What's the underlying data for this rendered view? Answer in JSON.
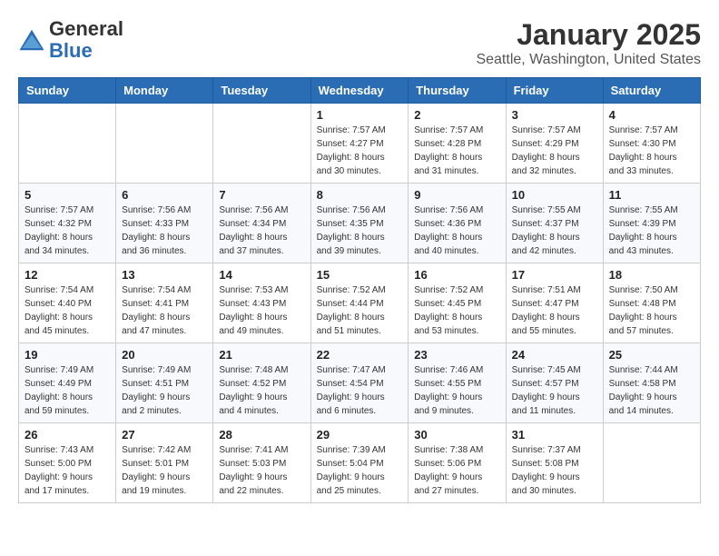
{
  "header": {
    "logo_line1": "General",
    "logo_line2": "Blue",
    "month": "January 2025",
    "location": "Seattle, Washington, United States"
  },
  "weekdays": [
    "Sunday",
    "Monday",
    "Tuesday",
    "Wednesday",
    "Thursday",
    "Friday",
    "Saturday"
  ],
  "weeks": [
    [
      {
        "day": "",
        "info": ""
      },
      {
        "day": "",
        "info": ""
      },
      {
        "day": "",
        "info": ""
      },
      {
        "day": "1",
        "info": "Sunrise: 7:57 AM\nSunset: 4:27 PM\nDaylight: 8 hours\nand 30 minutes."
      },
      {
        "day": "2",
        "info": "Sunrise: 7:57 AM\nSunset: 4:28 PM\nDaylight: 8 hours\nand 31 minutes."
      },
      {
        "day": "3",
        "info": "Sunrise: 7:57 AM\nSunset: 4:29 PM\nDaylight: 8 hours\nand 32 minutes."
      },
      {
        "day": "4",
        "info": "Sunrise: 7:57 AM\nSunset: 4:30 PM\nDaylight: 8 hours\nand 33 minutes."
      }
    ],
    [
      {
        "day": "5",
        "info": "Sunrise: 7:57 AM\nSunset: 4:32 PM\nDaylight: 8 hours\nand 34 minutes."
      },
      {
        "day": "6",
        "info": "Sunrise: 7:56 AM\nSunset: 4:33 PM\nDaylight: 8 hours\nand 36 minutes."
      },
      {
        "day": "7",
        "info": "Sunrise: 7:56 AM\nSunset: 4:34 PM\nDaylight: 8 hours\nand 37 minutes."
      },
      {
        "day": "8",
        "info": "Sunrise: 7:56 AM\nSunset: 4:35 PM\nDaylight: 8 hours\nand 39 minutes."
      },
      {
        "day": "9",
        "info": "Sunrise: 7:56 AM\nSunset: 4:36 PM\nDaylight: 8 hours\nand 40 minutes."
      },
      {
        "day": "10",
        "info": "Sunrise: 7:55 AM\nSunset: 4:37 PM\nDaylight: 8 hours\nand 42 minutes."
      },
      {
        "day": "11",
        "info": "Sunrise: 7:55 AM\nSunset: 4:39 PM\nDaylight: 8 hours\nand 43 minutes."
      }
    ],
    [
      {
        "day": "12",
        "info": "Sunrise: 7:54 AM\nSunset: 4:40 PM\nDaylight: 8 hours\nand 45 minutes."
      },
      {
        "day": "13",
        "info": "Sunrise: 7:54 AM\nSunset: 4:41 PM\nDaylight: 8 hours\nand 47 minutes."
      },
      {
        "day": "14",
        "info": "Sunrise: 7:53 AM\nSunset: 4:43 PM\nDaylight: 8 hours\nand 49 minutes."
      },
      {
        "day": "15",
        "info": "Sunrise: 7:52 AM\nSunset: 4:44 PM\nDaylight: 8 hours\nand 51 minutes."
      },
      {
        "day": "16",
        "info": "Sunrise: 7:52 AM\nSunset: 4:45 PM\nDaylight: 8 hours\nand 53 minutes."
      },
      {
        "day": "17",
        "info": "Sunrise: 7:51 AM\nSunset: 4:47 PM\nDaylight: 8 hours\nand 55 minutes."
      },
      {
        "day": "18",
        "info": "Sunrise: 7:50 AM\nSunset: 4:48 PM\nDaylight: 8 hours\nand 57 minutes."
      }
    ],
    [
      {
        "day": "19",
        "info": "Sunrise: 7:49 AM\nSunset: 4:49 PM\nDaylight: 8 hours\nand 59 minutes."
      },
      {
        "day": "20",
        "info": "Sunrise: 7:49 AM\nSunset: 4:51 PM\nDaylight: 9 hours\nand 2 minutes."
      },
      {
        "day": "21",
        "info": "Sunrise: 7:48 AM\nSunset: 4:52 PM\nDaylight: 9 hours\nand 4 minutes."
      },
      {
        "day": "22",
        "info": "Sunrise: 7:47 AM\nSunset: 4:54 PM\nDaylight: 9 hours\nand 6 minutes."
      },
      {
        "day": "23",
        "info": "Sunrise: 7:46 AM\nSunset: 4:55 PM\nDaylight: 9 hours\nand 9 minutes."
      },
      {
        "day": "24",
        "info": "Sunrise: 7:45 AM\nSunset: 4:57 PM\nDaylight: 9 hours\nand 11 minutes."
      },
      {
        "day": "25",
        "info": "Sunrise: 7:44 AM\nSunset: 4:58 PM\nDaylight: 9 hours\nand 14 minutes."
      }
    ],
    [
      {
        "day": "26",
        "info": "Sunrise: 7:43 AM\nSunset: 5:00 PM\nDaylight: 9 hours\nand 17 minutes."
      },
      {
        "day": "27",
        "info": "Sunrise: 7:42 AM\nSunset: 5:01 PM\nDaylight: 9 hours\nand 19 minutes."
      },
      {
        "day": "28",
        "info": "Sunrise: 7:41 AM\nSunset: 5:03 PM\nDaylight: 9 hours\nand 22 minutes."
      },
      {
        "day": "29",
        "info": "Sunrise: 7:39 AM\nSunset: 5:04 PM\nDaylight: 9 hours\nand 25 minutes."
      },
      {
        "day": "30",
        "info": "Sunrise: 7:38 AM\nSunset: 5:06 PM\nDaylight: 9 hours\nand 27 minutes."
      },
      {
        "day": "31",
        "info": "Sunrise: 7:37 AM\nSunset: 5:08 PM\nDaylight: 9 hours\nand 30 minutes."
      },
      {
        "day": "",
        "info": ""
      }
    ]
  ]
}
